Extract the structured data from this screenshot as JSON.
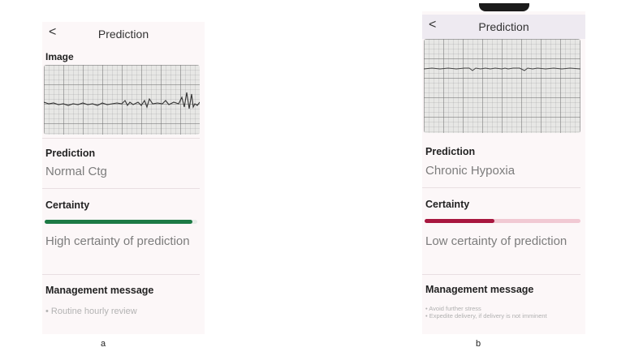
{
  "screen_a": {
    "title": "Prediction",
    "back": "<",
    "image_label": "Image",
    "prediction_label": "Prediction",
    "prediction_value": "Normal Ctg",
    "certainty_label": "Certainty",
    "certainty_level": 0.97,
    "certainty_color": "#1d7a45",
    "certainty_text": "High certainty of prediction",
    "management_label": "Management message",
    "management_items": [
      "• Routine hourly review"
    ],
    "caption": "a"
  },
  "screen_b": {
    "title": "Prediction",
    "back": "<",
    "prediction_label": "Prediction",
    "prediction_value": "Chronic Hypoxia",
    "certainty_label": "Certainty",
    "certainty_level": 0.45,
    "certainty_color": "#a8173f",
    "certainty_track_color": "#f1c9d3",
    "certainty_text": "Low certainty of prediction",
    "management_label": "Management message",
    "management_items": [
      "• Avoid further stress",
      "• Expedite delivery, if delivery is not imminent"
    ],
    "caption": "b"
  }
}
